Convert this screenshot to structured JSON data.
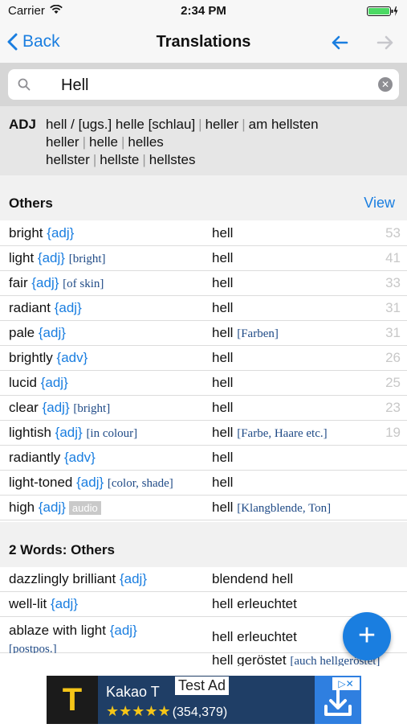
{
  "status": {
    "carrier": "Carrier",
    "time": "2:34 PM"
  },
  "nav": {
    "back_label": "Back",
    "title": "Translations"
  },
  "search": {
    "value": "Hell"
  },
  "forms": {
    "pos": "ADJ",
    "line1": [
      "hell / [ugs.] helle [schlau]",
      "heller",
      "am hellsten"
    ],
    "line2": [
      "heller",
      "helle",
      "helles"
    ],
    "line3": [
      "hellster",
      "hellste",
      "hellstes"
    ]
  },
  "others": {
    "title": "Others",
    "view_label": "View",
    "rows": [
      {
        "term": "bright",
        "gram": "{adj}",
        "note": "",
        "badge": "",
        "trans": "hell",
        "tnote": "",
        "count": "53"
      },
      {
        "term": "light",
        "gram": "{adj}",
        "note": "[bright]",
        "badge": "",
        "trans": "hell",
        "tnote": "",
        "count": "41"
      },
      {
        "term": "fair",
        "gram": "{adj}",
        "note": "[of skin]",
        "badge": "",
        "trans": "hell",
        "tnote": "",
        "count": "33"
      },
      {
        "term": "radiant",
        "gram": "{adj}",
        "note": "",
        "badge": "",
        "trans": "hell",
        "tnote": "",
        "count": "31"
      },
      {
        "term": "pale",
        "gram": "{adj}",
        "note": "",
        "badge": "",
        "trans": "hell",
        "tnote": "[Farben]",
        "count": "31"
      },
      {
        "term": "brightly",
        "gram": "{adv}",
        "note": "",
        "badge": "",
        "trans": "hell",
        "tnote": "",
        "count": "26"
      },
      {
        "term": "lucid",
        "gram": "{adj}",
        "note": "",
        "badge": "",
        "trans": "hell",
        "tnote": "",
        "count": "25"
      },
      {
        "term": "clear",
        "gram": "{adj}",
        "note": "[bright]",
        "badge": "",
        "trans": "hell",
        "tnote": "",
        "count": "23"
      },
      {
        "term": "lightish",
        "gram": "{adj}",
        "note": "[in colour]",
        "badge": "",
        "trans": "hell",
        "tnote": "[Farbe, Haare etc.]",
        "count": "19"
      },
      {
        "term": "radiantly",
        "gram": "{adv}",
        "note": "",
        "badge": "",
        "trans": "hell",
        "tnote": "",
        "count": ""
      },
      {
        "term": "light-toned",
        "gram": "{adj}",
        "note": "[color, shade]",
        "badge": "",
        "trans": "hell",
        "tnote": "",
        "count": ""
      },
      {
        "term": "high",
        "gram": "{adj}",
        "note": "",
        "badge": "audio",
        "trans": "hell",
        "tnote": "[Klangblende, Ton]",
        "count": ""
      }
    ]
  },
  "two_words": {
    "title": "2 Words: Others",
    "rows": [
      {
        "term": "dazzlingly brilliant",
        "gram": "{adj}",
        "note": "",
        "trans": "blendend hell",
        "tnote": ""
      },
      {
        "term": "well-lit",
        "gram": "{adj}",
        "note": "",
        "trans": "hell erleuchtet",
        "tnote": ""
      },
      {
        "term": "ablaze with light",
        "gram": "{adj}",
        "note": "[postpos.]",
        "trans": "hell erleuchtet",
        "tnote": ""
      }
    ],
    "partial_row": {
      "trans": "hell geröstet",
      "tnote": "[auch hellgeröstet]"
    }
  },
  "fab": {
    "label": "+"
  },
  "ad": {
    "logo": "T",
    "app_name": "Kakao T",
    "tag": "Test Ad",
    "stars": "★★★★★",
    "ratings": "(354,379)"
  },
  "colors": {
    "accent": "#1a7ee0",
    "note": "#1f4a86",
    "count": "#c8c8c8"
  }
}
